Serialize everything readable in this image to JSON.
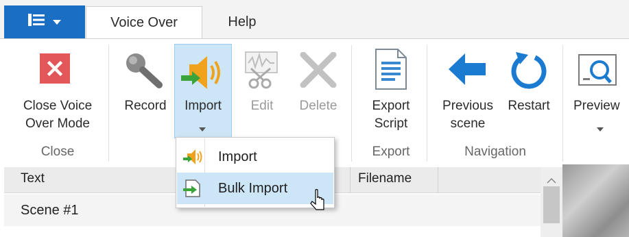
{
  "tabs": {
    "voice_over": "Voice Over",
    "help": "Help"
  },
  "ribbon": {
    "close_voice_over_line1": "Close Voice",
    "close_voice_over_line2": "Over Mode",
    "record": "Record",
    "import": "Import",
    "edit": "Edit",
    "delete": "Delete",
    "export_script_line1": "Export",
    "export_script_line2": "Script",
    "previous_scene_line1": "Previous",
    "previous_scene_line2": "scene",
    "restart": "Restart",
    "preview": "Preview",
    "groups": {
      "close": "Close",
      "export": "Export",
      "navigation": "Navigation"
    }
  },
  "dropdown": {
    "import": "Import",
    "bulk_import": "Bulk Import"
  },
  "grid": {
    "columns": [
      "Text",
      "Filename"
    ],
    "rows": [
      {
        "text": "Scene #1"
      }
    ]
  },
  "colors": {
    "accent": "#1a6fc4",
    "highlight": "#cde6f7",
    "close_red": "#e25757",
    "nav_blue": "#1b7bd0"
  },
  "icons": {
    "file_menu": "menu-list-icon",
    "close": "close-x-icon",
    "record": "microphone-icon",
    "import": "speaker-import-icon",
    "edit": "audio-cut-icon",
    "delete": "delete-x-icon",
    "export": "document-icon",
    "previous": "arrow-left-icon",
    "restart": "restart-icon",
    "preview": "magnifier-screen-icon"
  }
}
